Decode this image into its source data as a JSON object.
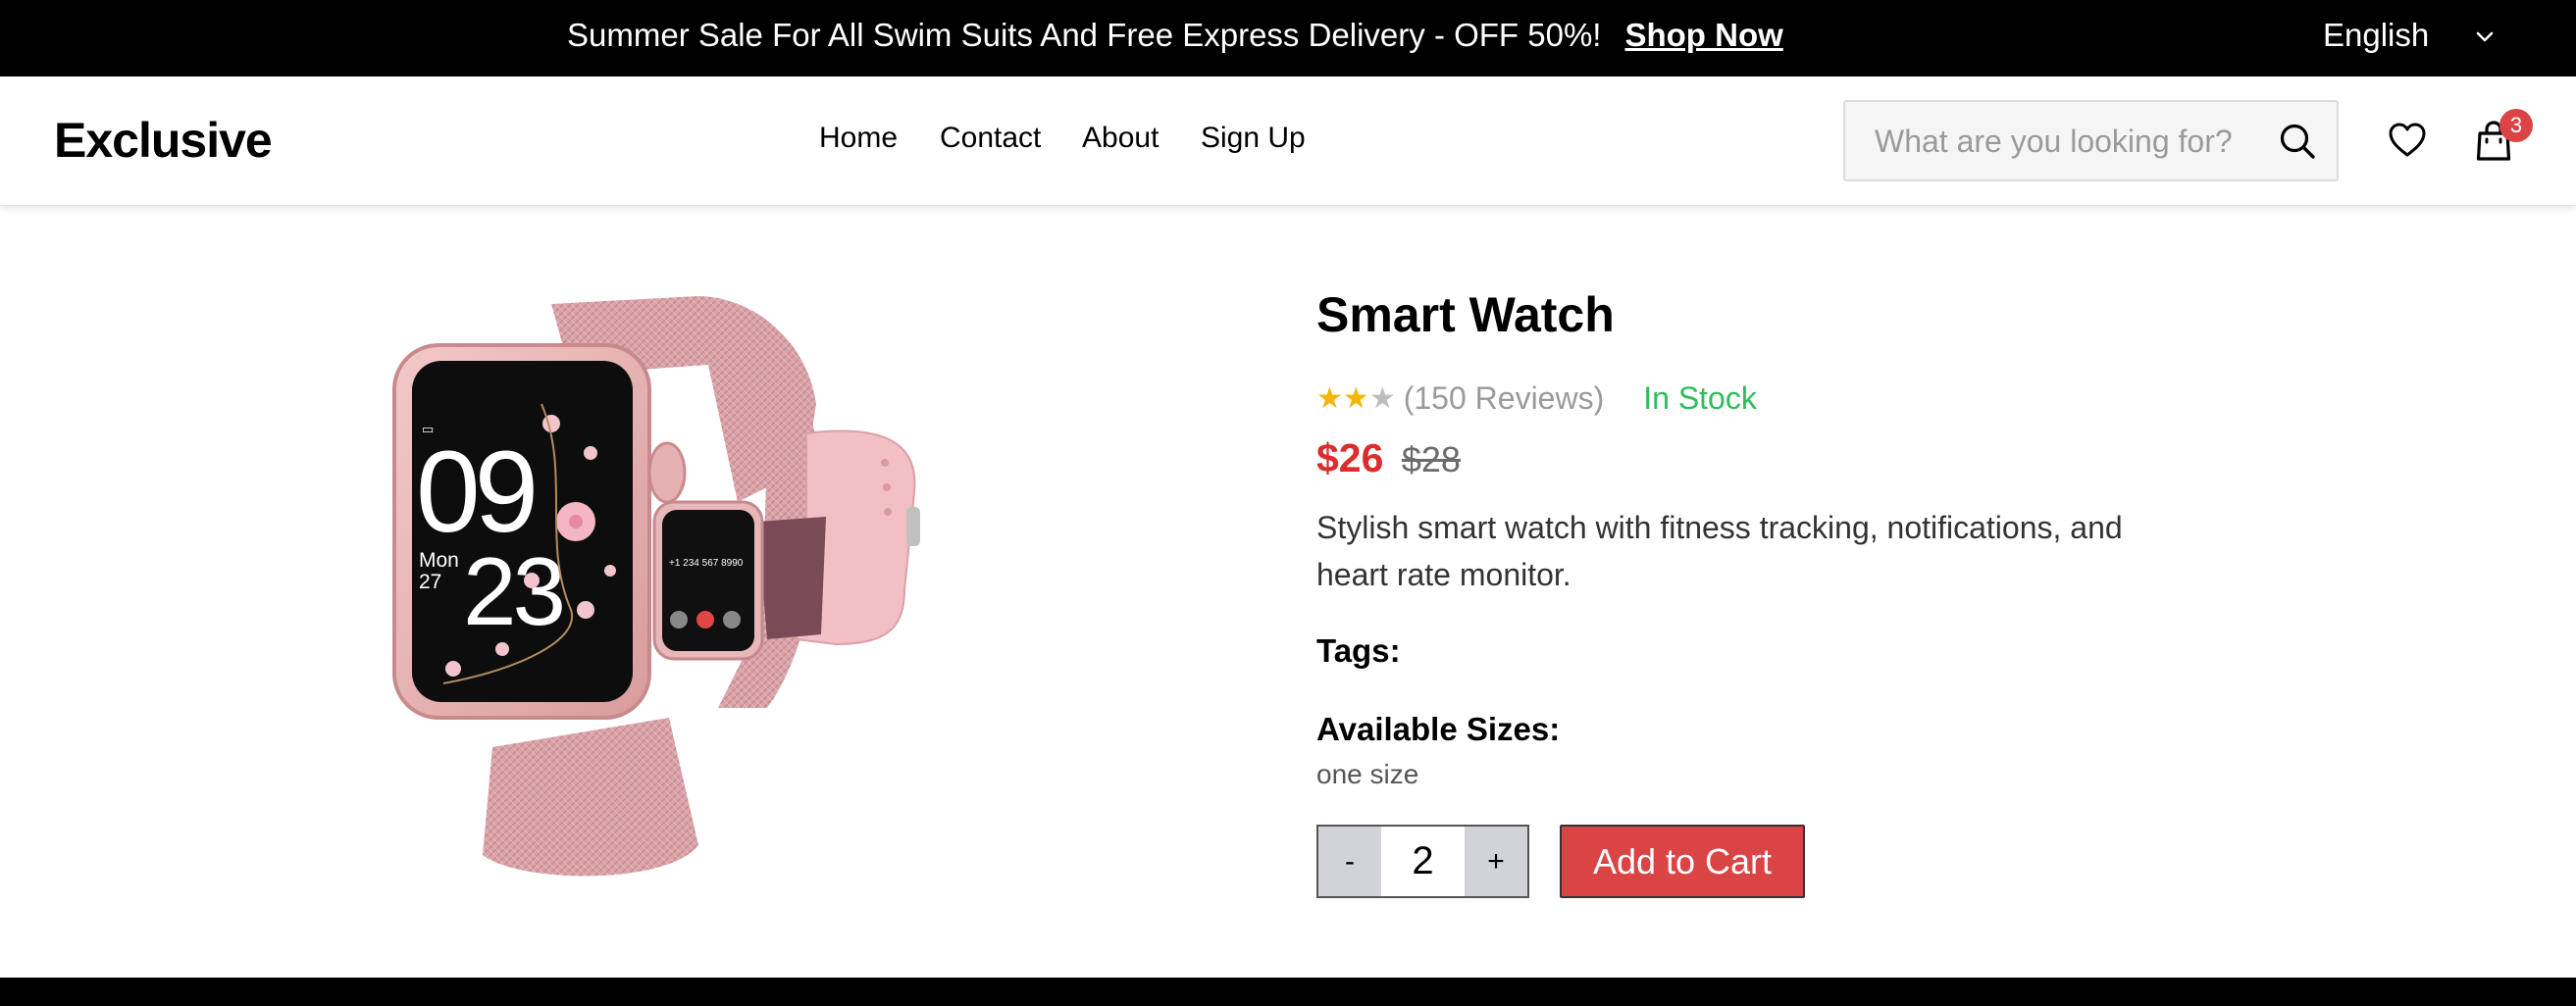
{
  "topbar": {
    "promo_text": "Summer Sale For All Swim Suits And Free Express Delivery - OFF 50%!",
    "shop_now": "Shop Now",
    "language": "English"
  },
  "header": {
    "logo": "Exclusive",
    "nav": [
      "Home",
      "Contact",
      "About",
      "Sign Up"
    ],
    "search_placeholder": "What are you looking for?",
    "cart_count": "3"
  },
  "product": {
    "title": "Smart Watch",
    "rating": {
      "value": 2,
      "max": 3
    },
    "reviews_text": "(150 Reviews)",
    "stock": "In Stock",
    "price": "$26",
    "old_price": "$28",
    "description": "Stylish smart watch with fitness tracking, notifications, and heart rate monitor.",
    "tags_label": "Tags:",
    "sizes_label": "Available Sizes:",
    "size_value": "one size",
    "quantity": {
      "decrement": "-",
      "value": "2",
      "increment": "+"
    },
    "add_to_cart": "Add to Cart"
  },
  "colors": {
    "accent": "#db4444",
    "price": "#db2d2d",
    "in_stock": "#2ebd59",
    "star": "#f2b705",
    "topbar_bg": "#000000"
  },
  "icons": {
    "search": "search-icon",
    "wishlist": "heart-icon",
    "cart": "cart-icon",
    "language_dropdown": "chevron-down-icon"
  }
}
